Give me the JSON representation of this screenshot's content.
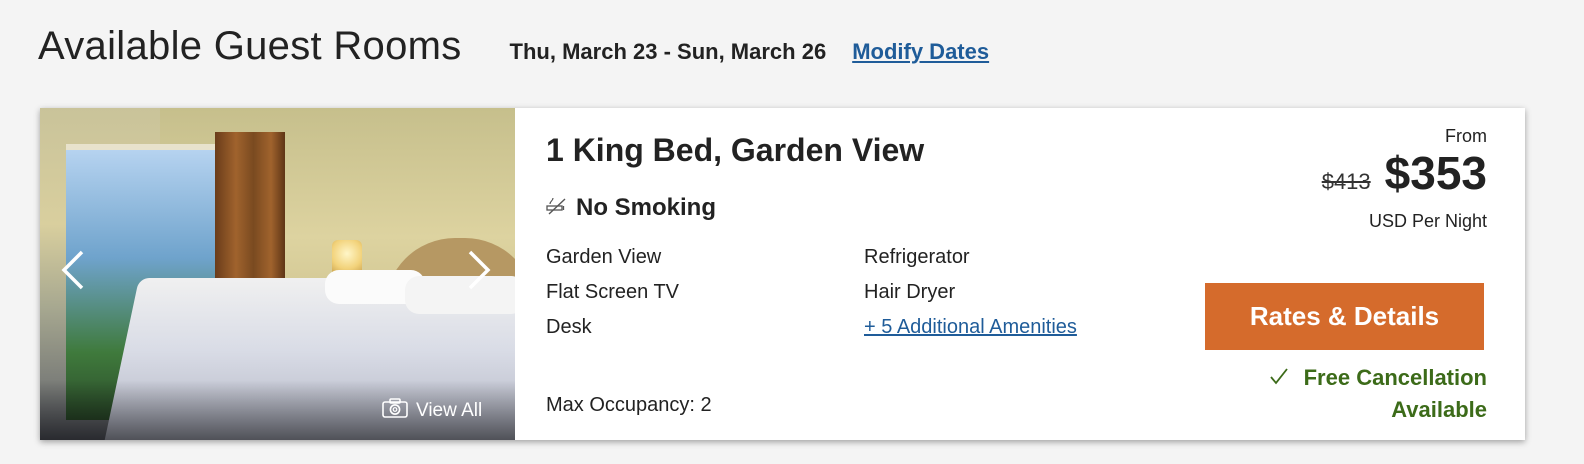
{
  "header": {
    "title": "Available Guest Rooms",
    "dates": "Thu, March 23 - Sun, March 26",
    "modify_label": "Modify Dates"
  },
  "room": {
    "name": "1 King Bed, Garden View",
    "smoking": "No Smoking",
    "amenities_left": [
      "Garden View",
      "Flat Screen TV",
      "Desk"
    ],
    "amenities_right": [
      "Refrigerator",
      "Hair Dryer"
    ],
    "more_amenities_label": "+ 5 Additional Amenities",
    "occupancy": "Max Occupancy: 2",
    "photo": {
      "view_all_label": "View All",
      "icons": [
        "chevron-left-icon",
        "chevron-right-icon",
        "camera-icon"
      ]
    },
    "pricing": {
      "from_label": "From",
      "old_price": "$413",
      "new_price": "$353",
      "unit": "USD Per Night"
    },
    "cta_label": "Rates & Details",
    "cancellation": {
      "line1": "Free Cancellation",
      "line2": "Available"
    }
  },
  "colors": {
    "accent_button": "#d56b2c",
    "link": "#1f5c99",
    "cancellation_green": "#3c6b19",
    "background": "#f4f4f4"
  }
}
